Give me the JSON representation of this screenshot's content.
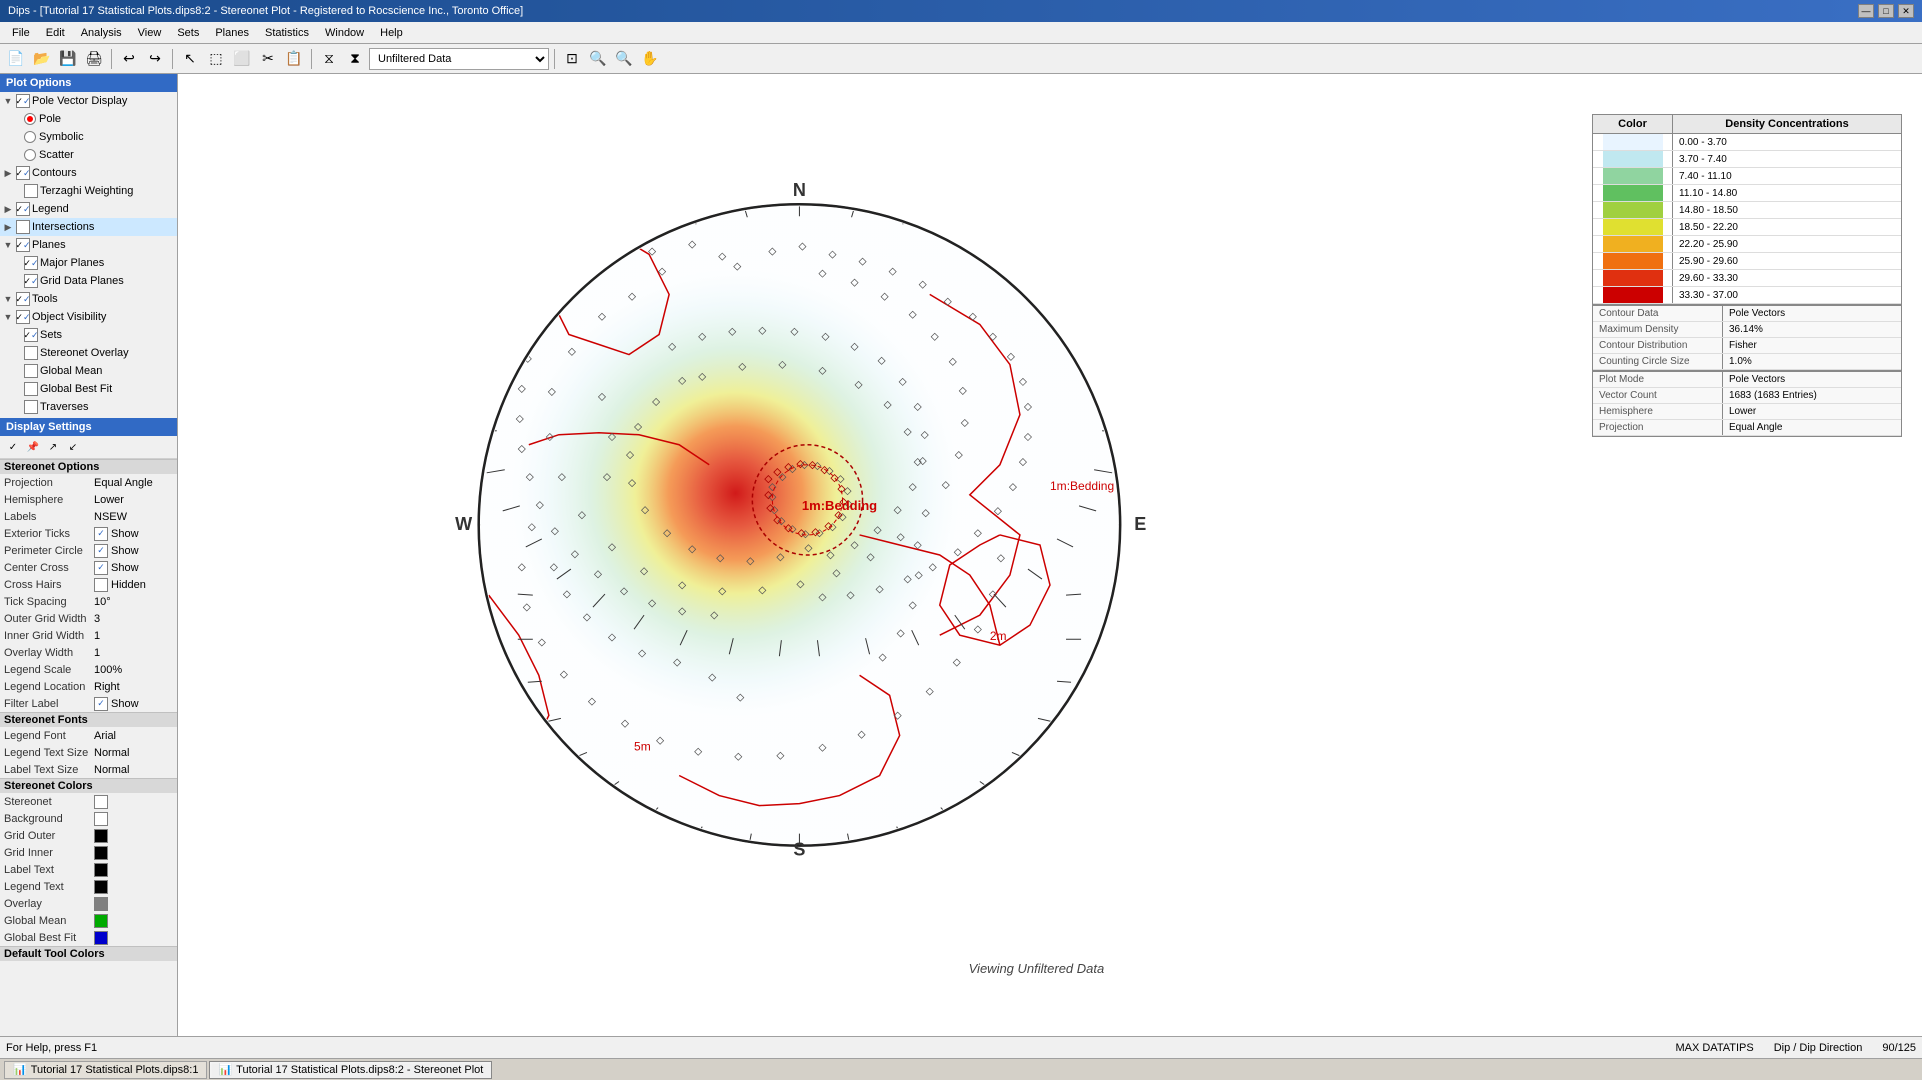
{
  "titleBar": {
    "title": "Dips - [Tutorial 17 Statistical Plots.dips8:2 - Stereonet Plot - Registered to Rocscience Inc., Toronto Office]",
    "controls": [
      "minimize",
      "maximize",
      "close"
    ]
  },
  "menuBar": {
    "items": [
      "File",
      "Edit",
      "Analysis",
      "View",
      "Sets",
      "Planes",
      "Statistics",
      "Window",
      "Help"
    ]
  },
  "toolbar": {
    "filterLabel": "Unfiltered Data"
  },
  "leftPanel": {
    "plotOptionsHeader": "Plot Options",
    "tree": {
      "poleVectorDisplay": "Pole Vector Display",
      "pole": "Pole",
      "symbolic": "Symbolic",
      "scatter": "Scatter",
      "contours": "Contours",
      "terzaghiWeighting": "Terzaghi Weighting",
      "legend": "Legend",
      "intersections": "Intersections",
      "planes": "Planes",
      "majorPlanes": "Major Planes",
      "gridDataPlanes": "Grid Data Planes",
      "tools": "Tools",
      "objectVisibility": "Object Visibility",
      "sets": "Sets",
      "stereonetOverlay": "Stereonet Overlay",
      "globalMean": "Global Mean",
      "globalBestFit": "Global Best Fit",
      "traverses": "Traverses"
    },
    "displaySettingsHeader": "Display Settings",
    "stereonetOptions": "Stereonet Options",
    "properties": {
      "projection": {
        "label": "Projection",
        "value": "Equal Angle"
      },
      "hemisphere": {
        "label": "Hemisphere",
        "value": "Lower"
      },
      "labels": {
        "label": "Labels",
        "value": "NSEW"
      },
      "exteriorTicks": {
        "label": "Exterior Ticks",
        "value": "Show",
        "checked": true
      },
      "perimeterCircle": {
        "label": "Perimeter Circle",
        "value": "Show",
        "checked": true
      },
      "centerCross": {
        "label": "Center Cross",
        "value": "Show",
        "checked": true
      },
      "crossHairs": {
        "label": "Cross Hairs",
        "value": "Hidden",
        "checked": false
      },
      "tickSpacing": {
        "label": "Tick Spacing",
        "value": "10°"
      },
      "outerGridWidth": {
        "label": "Outer Grid Width",
        "value": "3"
      },
      "innerGridWidth": {
        "label": "Inner Grid Width",
        "value": "1"
      },
      "overlayWidth": {
        "label": "Overlay Width",
        "value": "1"
      },
      "legendScale": {
        "label": "Legend Scale",
        "value": "100%"
      },
      "legendLocation": {
        "label": "Legend Location",
        "value": "Right"
      },
      "filterLabel": {
        "label": "Filter Label",
        "value": "Show",
        "checked": true
      }
    },
    "stereonetFonts": "Stereonet Fonts",
    "fonts": {
      "legendFont": {
        "label": "Legend Font",
        "value": "Arial"
      },
      "legendTextSize": {
        "label": "Legend Text Size",
        "value": "Normal"
      },
      "labelTextSize": {
        "label": "Label Text Size",
        "value": "Normal"
      }
    },
    "stereonetColors": "Stereonet Colors",
    "colors": {
      "stereonet": {
        "label": "Stereonet",
        "color": "#ffffff"
      },
      "background": {
        "label": "Background",
        "color": "#ffffff"
      },
      "gridOuter": {
        "label": "Grid Outer",
        "color": "#000000"
      },
      "gridInner": {
        "label": "Grid Inner",
        "color": "#000000"
      },
      "labelText": {
        "label": "Label Text",
        "color": "#000000"
      },
      "legendText": {
        "label": "Legend Text",
        "color": "#000000"
      },
      "overlay": {
        "label": "Overlay",
        "color": "#808080"
      },
      "globalMean": {
        "label": "Global Mean",
        "color": "#00aa00"
      },
      "globalBestFit": {
        "label": "Global Best Fit",
        "color": "#0000cc"
      }
    },
    "defaultToolColors": "Default Tool Colors"
  },
  "stereonet": {
    "northLabel": "N",
    "southLabel": "S",
    "eastLabel": "E",
    "westLabel": "W",
    "beddingLabel": "1m:Bedding",
    "beddingLabel2": "1m:Bedding",
    "label2m": "2m",
    "label5m": "5m",
    "viewingText": "Viewing Unfiltered Data"
  },
  "legend": {
    "colorHeader": "Color",
    "densityHeader": "Density Concentrations",
    "ranges": [
      {
        "min": "0.00",
        "dash": "-",
        "max": "3.70",
        "color": "#e8f4ff"
      },
      {
        "min": "3.70",
        "dash": "-",
        "max": "7.40",
        "color": "#c0e8f0"
      },
      {
        "min": "7.40",
        "dash": "-",
        "max": "11.10",
        "color": "#90d4a0"
      },
      {
        "min": "11.10",
        "dash": "-",
        "max": "14.80",
        "color": "#60c060"
      },
      {
        "min": "14.80",
        "dash": "-",
        "max": "18.50",
        "color": "#a0d040"
      },
      {
        "min": "18.50",
        "dash": "-",
        "max": "22.20",
        "color": "#e0e030"
      },
      {
        "min": "22.20",
        "dash": "-",
        "max": "25.90",
        "color": "#f0b020"
      },
      {
        "min": "25.90",
        "dash": "-",
        "max": "29.60",
        "color": "#f07010"
      },
      {
        "min": "29.60",
        "dash": "-",
        "max": "33.30",
        "color": "#e03010"
      },
      {
        "min": "33.30",
        "dash": "-",
        "max": "37.00",
        "color": "#cc0000"
      }
    ],
    "contourData": {
      "label": "Contour Data",
      "value": "Pole Vectors"
    },
    "maximumDensity": {
      "label": "Maximum Density",
      "value": "36.14%"
    },
    "contourDistribution": {
      "label": "Contour Distribution",
      "value": "Fisher"
    },
    "countingCircleSize": {
      "label": "Counting Circle Size",
      "value": "1.0%"
    },
    "plotMode": {
      "label": "Plot Mode",
      "value": "Pole Vectors"
    },
    "vectorCount": {
      "label": "Vector Count",
      "value": "1683 (1683 Entries)"
    },
    "hemisphere": {
      "label": "Hemisphere",
      "value": "Lower"
    },
    "projection": {
      "label": "Projection",
      "value": "Equal Angle"
    }
  },
  "statusBar": {
    "helpText": "For Help, press F1",
    "maxDatatips": "MAX DATATIPS",
    "dipDirection": "Dip / Dip Direction",
    "coordinates": "90/125"
  },
  "taskbar": {
    "items": [
      {
        "label": "Tutorial 17 Statistical Plots.dips8:1",
        "active": false
      },
      {
        "label": "Tutorial 17 Statistical Plots.dips8:2 - Stereonet Plot",
        "active": true
      }
    ]
  }
}
